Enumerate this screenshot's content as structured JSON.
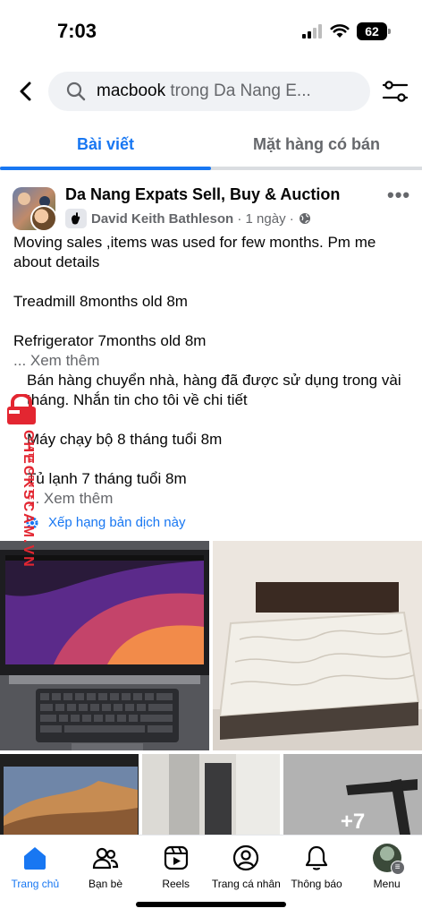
{
  "status_bar": {
    "time": "7:03",
    "battery": "62"
  },
  "search": {
    "query": "macbook",
    "scope": " trong Da Nang E..."
  },
  "tabs": [
    {
      "label": "Bài viết",
      "active": true
    },
    {
      "label": "Mặt hàng có bán",
      "active": false
    }
  ],
  "post": {
    "group_name": "Da Nang Expats Sell, Buy & Auction",
    "author": "David Keith Bathleson",
    "time_ago": "1 ngày",
    "original_lines": [
      "Moving sales ,items was used for few months. Pm me about details",
      "Treadmill 8months old 8m",
      "Refrigerator 7months old 8m"
    ],
    "see_more": "... Xem thêm",
    "translated_lines": [
      "Bán hàng chuyển nhà, hàng đã được sử dụng trong vài tháng. Nhắn tin cho tôi về chi tiết",
      "Máy chạy bộ 8 tháng tuổi 8m",
      "Tủ lạnh 7 tháng tuổi 8m"
    ],
    "see_more_translated": "... Xem thêm",
    "rate_translation": "Xếp hạng bản dịch này",
    "more_photos": "+7"
  },
  "watermark": {
    "side_text": "CHECKSCAM.VN",
    "side_subtext": "DATA CENTER"
  },
  "bottom_nav": [
    {
      "label": "Trang chủ",
      "icon": "home-icon",
      "active": true
    },
    {
      "label": "Bạn bè",
      "icon": "friends-icon",
      "active": false
    },
    {
      "label": "Reels",
      "icon": "reels-icon",
      "active": false
    },
    {
      "label": "Trang cá nhân",
      "icon": "profile-icon",
      "active": false
    },
    {
      "label": "Thông báo",
      "icon": "bell-icon",
      "active": false
    },
    {
      "label": "Menu",
      "icon": "menu-avatar",
      "active": false
    }
  ],
  "colors": {
    "accent": "#1877f2",
    "secondary_text": "#65676b",
    "watermark": "#e32631"
  }
}
